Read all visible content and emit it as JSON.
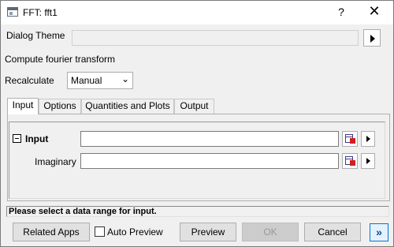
{
  "window": {
    "title": "FFT: fft1",
    "help_glyph": "?",
    "close_glyph": "✕"
  },
  "dialog_theme": {
    "label": "Dialog Theme",
    "value": ""
  },
  "description": "Compute fourier transform",
  "recalculate": {
    "label": "Recalculate",
    "selected": "Manual"
  },
  "tabs": [
    {
      "label": "Input",
      "active": true
    },
    {
      "label": "Options",
      "active": false
    },
    {
      "label": "Quantities and Plots",
      "active": false
    },
    {
      "label": "Output",
      "active": false
    }
  ],
  "input_group": {
    "label": "Input",
    "fields": [
      {
        "label": "",
        "value": ""
      },
      {
        "label": "Imaginary",
        "value": ""
      }
    ]
  },
  "status_text": "Please select a data range for input.",
  "buttons": {
    "related_apps": "Related Apps",
    "auto_preview": "Auto Preview",
    "auto_preview_checked": false,
    "preview": "Preview",
    "ok": "OK",
    "cancel": "Cancel",
    "more": "»"
  },
  "icons": {
    "app": "window-icon",
    "range_select": "range-select-icon",
    "arrow": "right-arrow-icon",
    "collapse": "collapse-minus-icon"
  }
}
